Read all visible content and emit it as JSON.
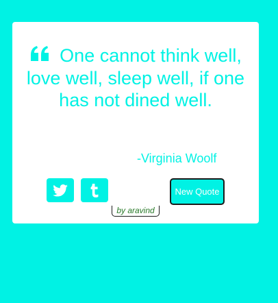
{
  "quote": {
    "text": "One cannot think well, love well, sleep well, if one has not dined well.",
    "author": "-Virginia Woolf",
    "quote_icon": "quote-left-icon"
  },
  "actions": {
    "twitter_icon": "twitter-icon",
    "tumblr_icon": "tumblr-icon",
    "new_quote_label": "New Quote"
  },
  "footer": {
    "credit": "by aravind"
  },
  "colors": {
    "background": "#00f2e4",
    "card": "#ffffff",
    "accent": "#00f2e4"
  }
}
